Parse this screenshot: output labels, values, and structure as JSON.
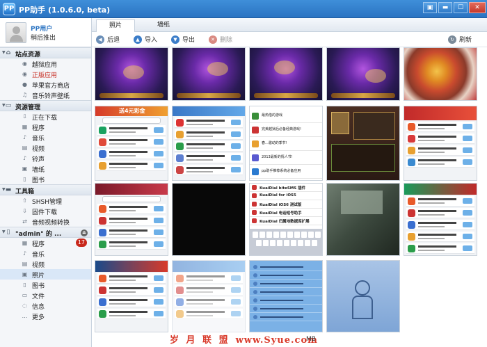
{
  "window": {
    "title": "PP助手 (1.0.6.0, beta)",
    "logo_text": "PP",
    "buttons": [
      "▣",
      "▬",
      "☐",
      "✕"
    ]
  },
  "user": {
    "name": "PP用户",
    "action": "稍后推出"
  },
  "sidebar": {
    "sections": [
      {
        "title": "站点资源",
        "items": [
          "越狱应用",
          "正版应用",
          "苹果官方商店",
          "音乐铃声壁纸"
        ]
      },
      {
        "title": "资源管理",
        "items": [
          "正在下载",
          "程序",
          "音乐",
          "视频",
          "铃声",
          "墙纸",
          "图书"
        ]
      },
      {
        "title": "工具箱",
        "items": [
          "SHSH管理",
          "固件下载",
          "音频视频转换"
        ]
      },
      {
        "title": "\"admin\" 的 ...",
        "items": [
          "程序",
          "音乐",
          "视频",
          "照片",
          "图书",
          "文件",
          "信息",
          "更多"
        ]
      }
    ],
    "badge_count": "17"
  },
  "tabs": [
    "照片",
    "墙纸"
  ],
  "toolbar": {
    "back": "后退",
    "import": "导入",
    "export": "导出",
    "delete": "删除",
    "refresh": "刷新"
  },
  "thumbs": {
    "row2": {
      "t1_header": "送4元彩金",
      "t3_rows": [
        "最热借的游戏",
        "完美越狱后必备经典游戏!",
        "春...邀动的季节!",
        "2013最新的情人节!",
        "pp助手推荐系统必备应用"
      ]
    },
    "row3": {
      "t3_rows": [
        "KuaiDial biteSMS 插件",
        "KuaiDial for iOS5",
        "KuaiDial iOS6 测试版",
        "KuaiDial 电话短号助手",
        "KuaiDial 归属地数据库扩展"
      ]
    }
  },
  "watermark": {
    "text": "岁 月 联 盟",
    "url": "www.Syue.com"
  },
  "status": {
    "tail": "MB"
  },
  "colors": {
    "titlebar": "#2a73c2",
    "accent": "#3f8fd9",
    "badge": "#c8281c"
  }
}
